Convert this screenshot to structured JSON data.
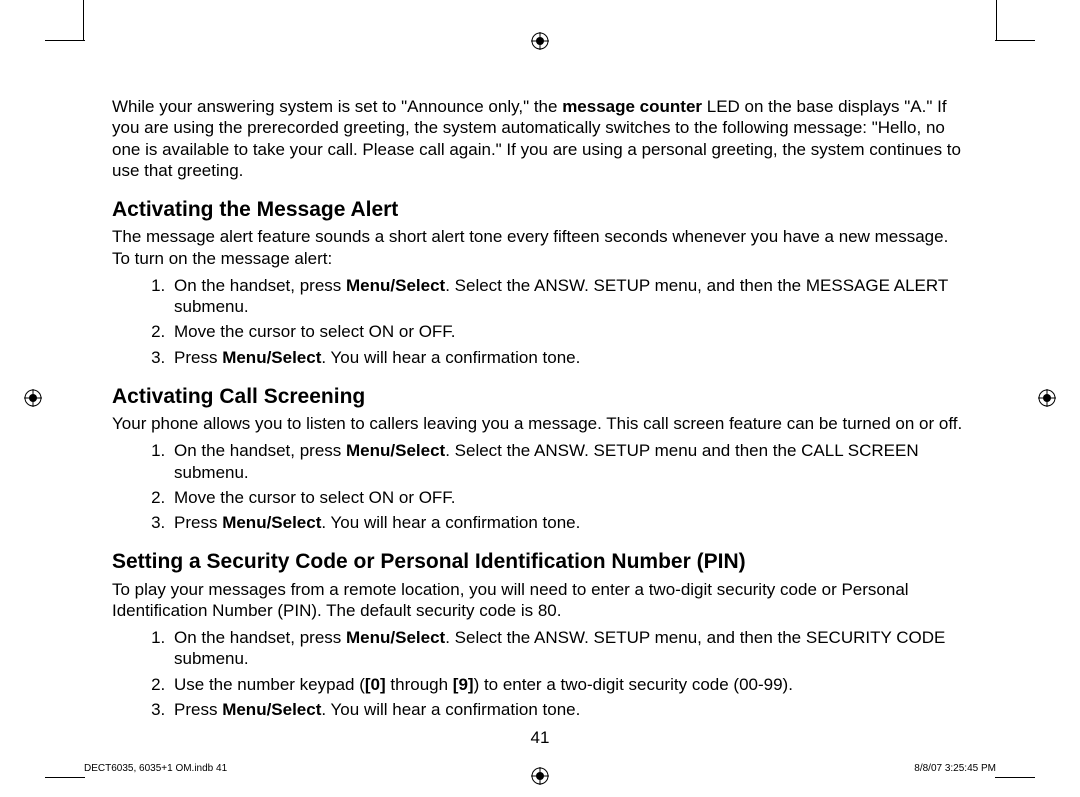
{
  "intro": {
    "p1a": "While your answering system is set to \"Announce only,\" the ",
    "p1b": "message counter",
    "p1c": " LED on the base displays \"A.\" If you are using the prerecorded greeting, the system automatically switches to the following message: \"Hello, no one is available to take your call. Please call again.\" If you are using a personal greeting, the system continues to use that greeting."
  },
  "section1": {
    "title": "Activating the Message Alert",
    "intro": "The message alert feature sounds a short alert tone every fifteen seconds whenever you have a new message. To turn on the message alert:",
    "step1a": "On the handset, press ",
    "step1b": "Menu/Select",
    "step1c": ". Select the ANSW. SETUP menu, and then the MESSAGE ALERT submenu.",
    "step2": "Move the cursor to select ON or OFF.",
    "step3a": "Press ",
    "step3b": "Menu/Select",
    "step3c": ". You will hear a confirmation tone."
  },
  "section2": {
    "title": "Activating Call Screening",
    "intro": "Your phone allows you to listen to callers leaving you a message. This call screen feature can be turned on or off.",
    "step1a": "On the handset, press ",
    "step1b": "Menu/Select",
    "step1c": ". Select the ANSW. SETUP menu and then the CALL SCREEN submenu.",
    "step2": "Move the cursor to select ON or OFF.",
    "step3a": "Press ",
    "step3b": "Menu/Select",
    "step3c": ". You will hear a confirmation tone."
  },
  "section3": {
    "title": "Setting a Security Code or Personal Identification Number (PIN)",
    "intro": "To play your messages from a remote location, you will need to enter a two-digit security code or Personal Identification Number (PIN). The default security code is 80.",
    "step1a": "On the handset, press ",
    "step1b": "Menu/Select",
    "step1c": ". Select the ANSW. SETUP menu, and then the SECURITY CODE submenu.",
    "step2a": "Use the number keypad (",
    "step2b": "[0]",
    "step2c": " through ",
    "step2d": "[9]",
    "step2e": ") to enter a two-digit security code (00-99).",
    "step3a": "Press ",
    "step3b": "Menu/Select",
    "step3c": ". You will hear a confirmation tone."
  },
  "page_number": "41",
  "footer": {
    "left": "DECT6035, 6035+1 OM.indb   41",
    "right": "8/8/07   3:25:45 PM"
  }
}
